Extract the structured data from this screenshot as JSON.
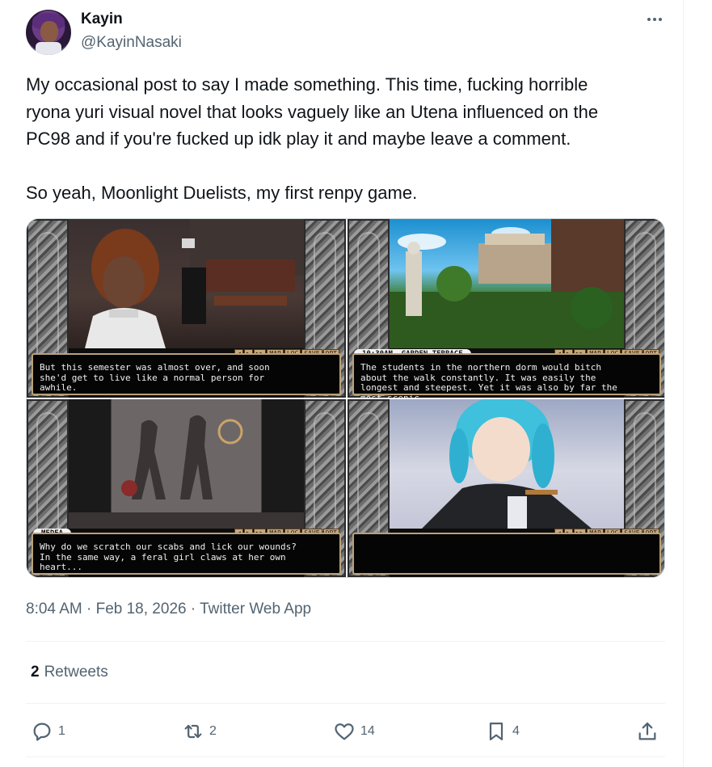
{
  "author": {
    "display_name": "Kayin",
    "handle": "@KayinNasaki"
  },
  "tweet": {
    "text": "My occasional post to say I made something. This time, fucking horrible\nryona yuri visual novel that looks vaguely like an Utena influenced on the\nPC98 and if you're fucked up idk play it and maybe leave a comment.\n\nSo yeah, Moonlight Duelists, my first renpy game."
  },
  "media": {
    "quick_menu": [
      "◀",
      "▶",
      "▶▶",
      "MAP",
      "LOG",
      "SAVE",
      "OPT"
    ],
    "shots": [
      {
        "nameplate": "",
        "dialogue": "But this semester was almost over, and soon\nshe'd get to live like a normal person for\nawhile."
      },
      {
        "nameplate": "10:30AM, GARDEN TERRACE",
        "dialogue": "The students in the northern dorm would bitch\nabout the walk constantly. It was easily the\nlongest and steepest. Yet it was also by far the\nmost scenic."
      },
      {
        "nameplate": "MEDEA",
        "dialogue": "Why do we scratch our scabs and lick our wounds?\nIn the same way, a feral girl claws at her own\nheart..."
      },
      {
        "nameplate": "",
        "dialogue": ""
      }
    ]
  },
  "meta": {
    "timestamp": "8:04 AM · Feb 18, 2026 · Twitter Web App"
  },
  "stats": {
    "retweet_count": "2",
    "retweet_label": "Retweets"
  },
  "actions": {
    "reply_count": "1",
    "retweet_count": "2",
    "like_count": "14",
    "bookmark_count": "4"
  },
  "colors": {
    "text_primary": "#0f1419",
    "text_secondary": "#536471",
    "divider": "#eff3f4"
  }
}
